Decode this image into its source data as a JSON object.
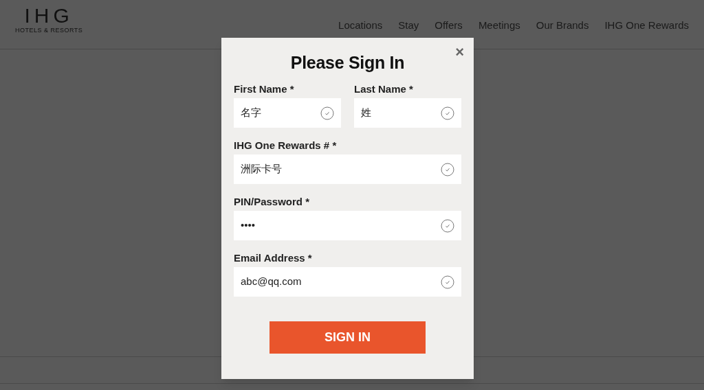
{
  "header": {
    "logo": {
      "mark": "IHG",
      "tagline": "HOTELS & RESORTS"
    },
    "nav": [
      {
        "label": "Locations"
      },
      {
        "label": "Stay"
      },
      {
        "label": "Offers"
      },
      {
        "label": "Meetings"
      },
      {
        "label": "Our Brands"
      },
      {
        "label": "IHG One Rewards"
      }
    ]
  },
  "dialog": {
    "title": "Please Sign In",
    "close": "×",
    "rows": [
      [
        {
          "label": "First Name *",
          "value": "名字",
          "valid": true
        },
        {
          "label": "Last Name *",
          "value": "姓",
          "valid": true
        }
      ],
      [
        {
          "label": "IHG One Rewards # *",
          "value": "洲际卡号",
          "valid": true
        }
      ],
      [
        {
          "label": "PIN/Password *",
          "value": "••••",
          "valid": true
        }
      ],
      [
        {
          "label": "Email Address *",
          "value": "abc@qq.com",
          "valid": true
        }
      ]
    ],
    "submit": "SIGN IN"
  }
}
